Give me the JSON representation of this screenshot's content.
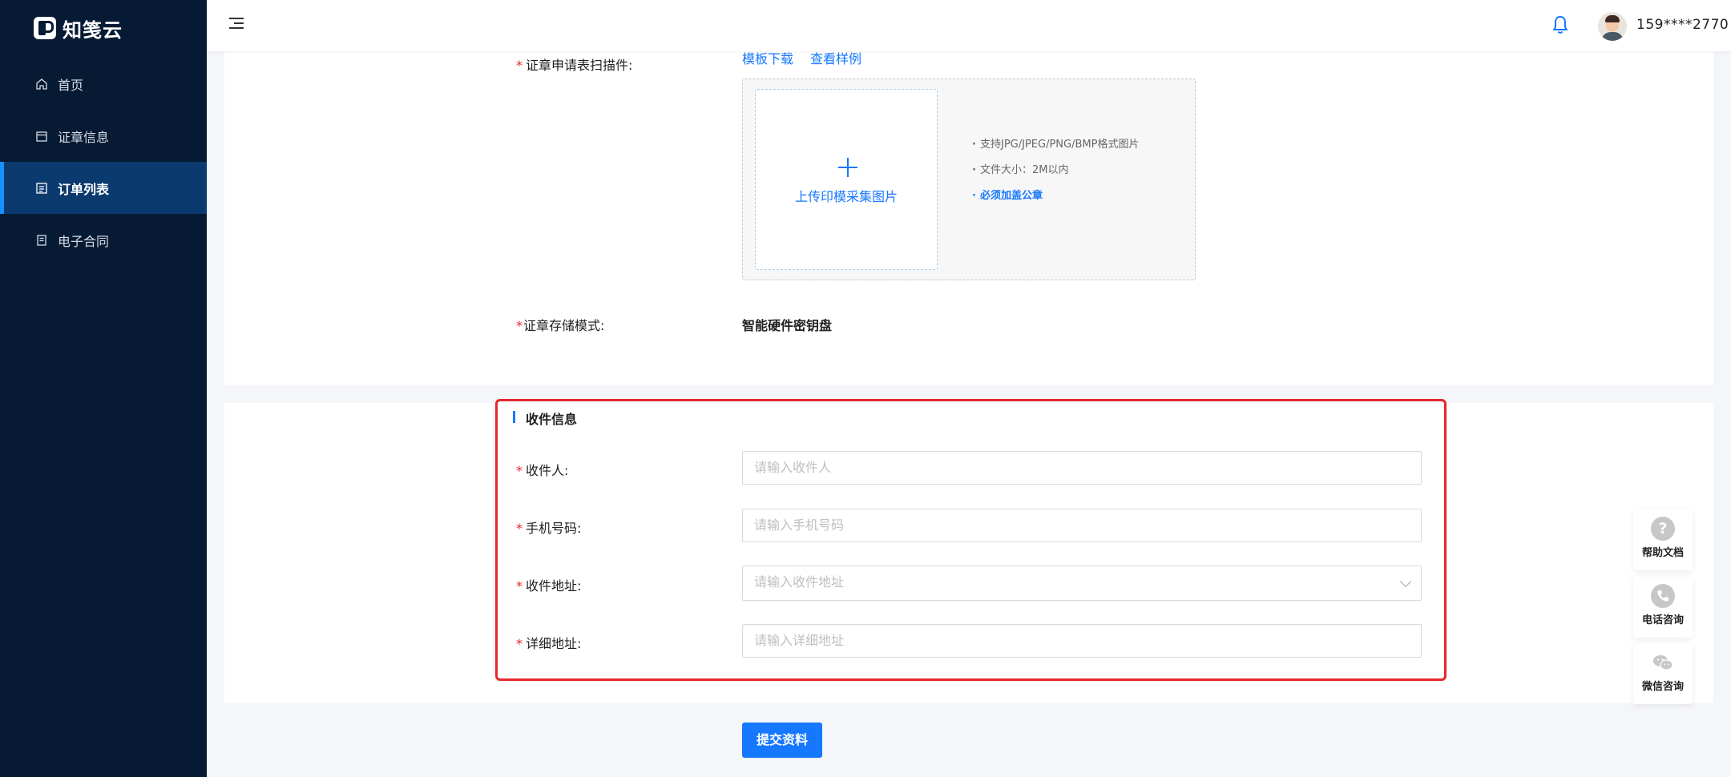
{
  "sidebar": {
    "logo_text": "知笺云",
    "items": [
      {
        "label": "首页"
      },
      {
        "label": "证章信息"
      },
      {
        "label": "订单列表"
      },
      {
        "label": "电子合同"
      }
    ]
  },
  "header": {
    "username": "159****2770"
  },
  "form": {
    "scan_label": "证章申请表扫描件:",
    "template_download": "模板下载",
    "view_example": "查看样例",
    "upload_text": "上传印模采集图片",
    "tips": [
      "支持JPG/JPEG/PNG/BMP格式图片",
      "文件大小：2M以内",
      "必须加盖公章"
    ],
    "storage_label": "证章存储模式:",
    "storage_value": "智能硬件密钥盘"
  },
  "shipping": {
    "title": "收件信息",
    "recipient_label": "收件人:",
    "recipient_placeholder": "请输入收件人",
    "phone_label": "手机号码:",
    "phone_placeholder": "请输入手机号码",
    "address_label": "收件地址:",
    "address_placeholder": "请输入收件地址",
    "detail_label": "详细地址:",
    "detail_placeholder": "请输入详细地址"
  },
  "submit_label": "提交资料",
  "floating": {
    "help": "帮助文档",
    "phone": "电话咨询",
    "wechat": "微信咨询"
  },
  "colors": {
    "sidebar_bg": "#071a33",
    "active_bg": "#0b3a6e",
    "primary": "#1677ff",
    "required": "#e8262b"
  }
}
